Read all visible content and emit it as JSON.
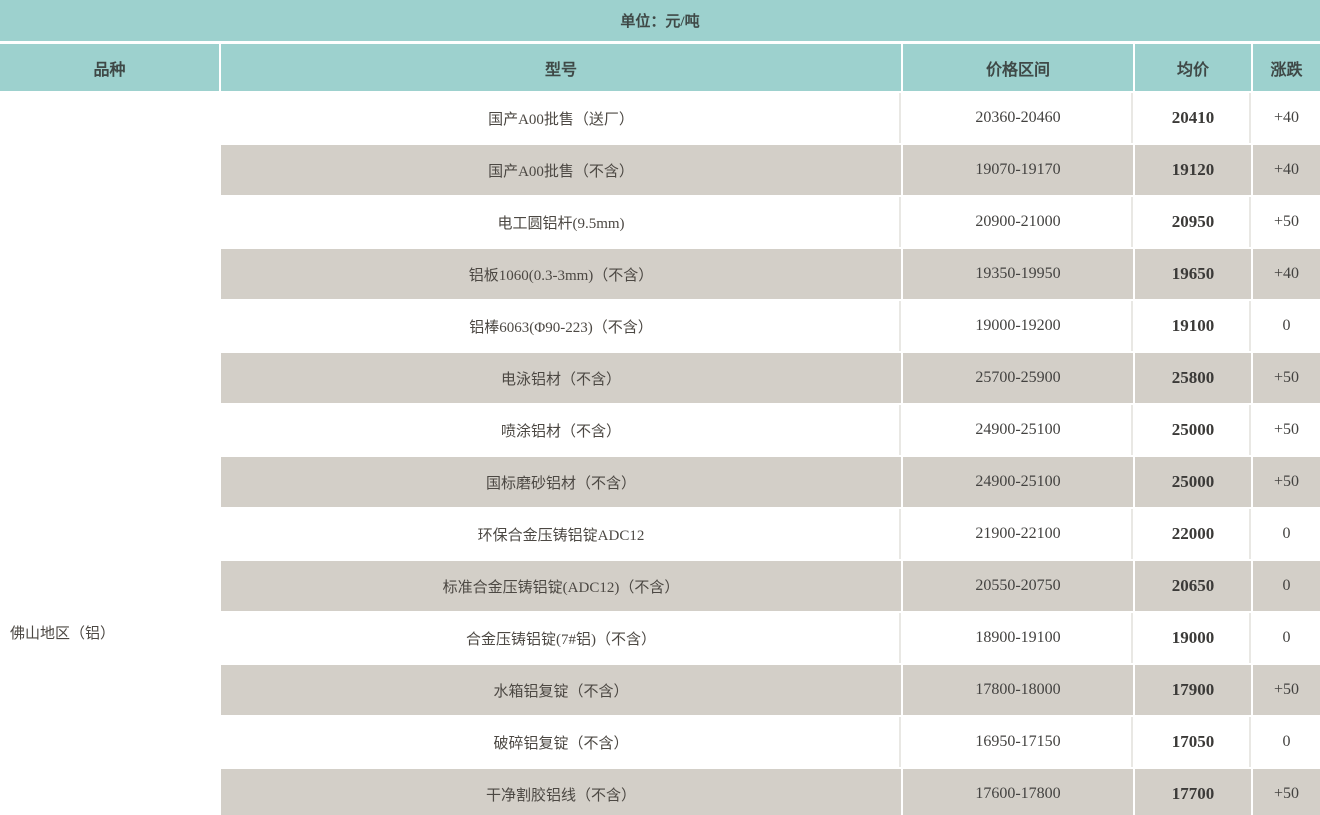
{
  "unit_bar": {
    "label": "单位：元/吨"
  },
  "table": {
    "columns": [
      "品种",
      "型号",
      "价格区间",
      "均价",
      "涨跌"
    ],
    "region": "佛山地区（铝）",
    "rows": [
      {
        "model": "国产A00批售（送厂）",
        "range": "20360-20460",
        "avg": "20410",
        "change": "+40"
      },
      {
        "model": "国产A00批售（不含）",
        "range": "19070-19170",
        "avg": "19120",
        "change": "+40"
      },
      {
        "model": "电工圆铝杆(9.5mm)",
        "range": "20900-21000",
        "avg": "20950",
        "change": "+50"
      },
      {
        "model": "铝板1060(0.3-3mm)（不含）",
        "range": "19350-19950",
        "avg": "19650",
        "change": "+40"
      },
      {
        "model": "铝棒6063(Φ90-223)（不含）",
        "range": "19000-19200",
        "avg": "19100",
        "change": "0"
      },
      {
        "model": "电泳铝材（不含）",
        "range": "25700-25900",
        "avg": "25800",
        "change": "+50"
      },
      {
        "model": "喷涂铝材（不含）",
        "range": "24900-25100",
        "avg": "25000",
        "change": "+50"
      },
      {
        "model": "国标磨砂铝材（不含）",
        "range": "24900-25100",
        "avg": "25000",
        "change": "+50"
      },
      {
        "model": "环保合金压铸铝锭ADC12",
        "range": "21900-22100",
        "avg": "22000",
        "change": "0"
      },
      {
        "model": "标准合金压铸铝锭(ADC12)（不含）",
        "range": "20550-20750",
        "avg": "20650",
        "change": "0"
      },
      {
        "model": "合金压铸铝锭(7#铝)（不含）",
        "range": "18900-19100",
        "avg": "19000",
        "change": "0"
      },
      {
        "model": "水箱铝复锭（不含）",
        "range": "17800-18000",
        "avg": "17900",
        "change": "+50"
      },
      {
        "model": "破碎铝复锭（不含）",
        "range": "16950-17150",
        "avg": "17050",
        "change": "0"
      },
      {
        "model": "干净割胶铝线（不含）",
        "range": "17600-17800",
        "avg": "17700",
        "change": "+50"
      }
    ]
  },
  "colors": {
    "header_teal": "#9dd1ce",
    "row_stripe": "#d3cfc8",
    "row_white": "#ffffff",
    "text": "#4c4843"
  }
}
